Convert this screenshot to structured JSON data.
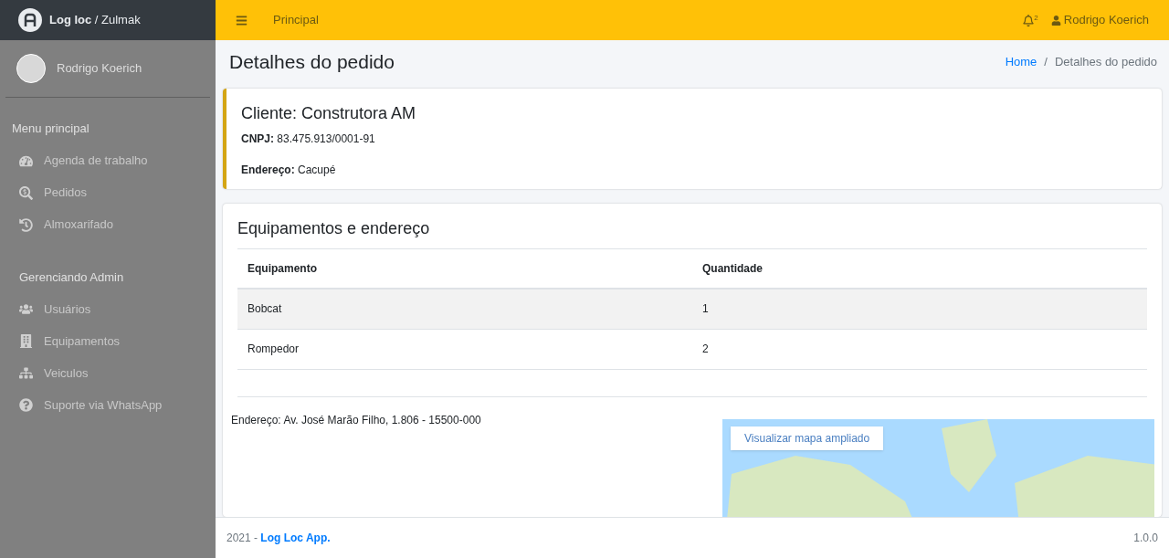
{
  "brand": {
    "title_bold": "Log loc",
    "title_rest": " / Zulmak"
  },
  "user": {
    "name": "Rodrigo Koerich"
  },
  "sidebar": {
    "sections": [
      {
        "title": "Menu principal",
        "items": [
          {
            "label": "Agenda de trabalho"
          },
          {
            "label": "Pedidos"
          },
          {
            "label": "Almoxarifado"
          }
        ]
      },
      {
        "title": "Gerenciando Admin",
        "items": [
          {
            "label": "Usuários"
          },
          {
            "label": "Equipamentos"
          },
          {
            "label": "Veiculos"
          },
          {
            "label": "Suporte via WhatsApp"
          }
        ]
      }
    ]
  },
  "topbar": {
    "link": "Principal",
    "notification_count": "2",
    "user": "Rodrigo Koerich"
  },
  "page": {
    "title": "Detalhes do pedido",
    "breadcrumb": [
      {
        "label": "Home"
      },
      {
        "label": "Detalhes do pedido"
      }
    ],
    "breadcrumb_separator": "/"
  },
  "client_card": {
    "title": "Cliente: Construtora AM",
    "fields": [
      {
        "label": "CNPJ:",
        "value": "83.475.913/0001-91"
      },
      {
        "label": "Endereço:",
        "value": "Cacupé"
      }
    ]
  },
  "equipment_card": {
    "title": "Equipamentos e endereço",
    "table": {
      "columns": [
        "Equipamento",
        "Quantidade"
      ],
      "rows": [
        [
          "Bobcat",
          "1"
        ],
        [
          "Rompedor",
          "2"
        ]
      ]
    },
    "address": "Endereço: Av. José Marão Filho, 1.806 - 15500-000",
    "map_button": "Visualizar mapa ampliado"
  },
  "footer": {
    "year": "2021 - ",
    "app": "Log Loc App.",
    "version": "1.0.0"
  }
}
